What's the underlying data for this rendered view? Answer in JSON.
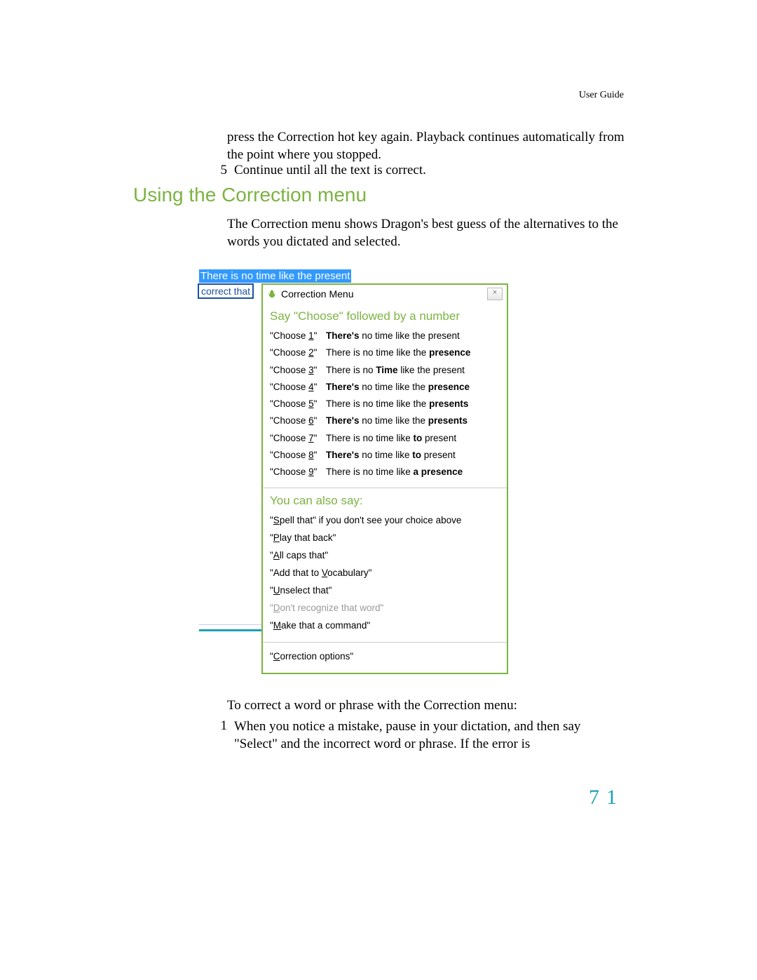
{
  "header": {
    "label": "User Guide"
  },
  "paragraphs": {
    "p1": "press the Correction hot key again. Playback continues automatically from the point where you stopped.",
    "step5_num": "5",
    "step5_text": "Continue until all the text is correct.",
    "p2": "The Correction menu shows Dragon's best guess of the alternatives to the words you dictated and selected.",
    "p3": "To correct a word or phrase with the Correction menu:",
    "step1_num": "1",
    "step1_text": "When you notice a mistake, pause in your dictation, and then say \"Select\" and the incorrect word or phrase. If the error is"
  },
  "section_heading": "Using the Correction menu",
  "annotation": {
    "label": "correct that"
  },
  "selected_text": "There is no time like the present",
  "menu": {
    "title": "Correction Menu",
    "close": "×",
    "choose_heading": "Say \"Choose\" followed by a number",
    "choices": [
      {
        "num": "1",
        "parts": [
          {
            "t": "There's",
            "b": true
          },
          {
            "t": " no time like the present",
            "b": false
          }
        ]
      },
      {
        "num": "2",
        "parts": [
          {
            "t": "There is no time like the ",
            "b": false
          },
          {
            "t": "presence",
            "b": true
          }
        ]
      },
      {
        "num": "3",
        "parts": [
          {
            "t": "There is no ",
            "b": false
          },
          {
            "t": "Time",
            "b": true
          },
          {
            "t": " like the present",
            "b": false
          }
        ]
      },
      {
        "num": "4",
        "parts": [
          {
            "t": "There's",
            "b": true
          },
          {
            "t": " no time like the ",
            "b": false
          },
          {
            "t": "presence",
            "b": true
          }
        ]
      },
      {
        "num": "5",
        "parts": [
          {
            "t": "There is no time like the ",
            "b": false
          },
          {
            "t": "presents",
            "b": true
          }
        ]
      },
      {
        "num": "6",
        "parts": [
          {
            "t": "There's",
            "b": true
          },
          {
            "t": " no time like the ",
            "b": false
          },
          {
            "t": "presents",
            "b": true
          }
        ]
      },
      {
        "num": "7",
        "parts": [
          {
            "t": "There is no time like ",
            "b": false
          },
          {
            "t": "to",
            "b": true
          },
          {
            "t": " present",
            "b": false
          }
        ]
      },
      {
        "num": "8",
        "parts": [
          {
            "t": "There's",
            "b": true
          },
          {
            "t": " no time like ",
            "b": false
          },
          {
            "t": "to",
            "b": true
          },
          {
            "t": " present",
            "b": false
          }
        ]
      },
      {
        "num": "9",
        "parts": [
          {
            "t": "There is no time like ",
            "b": false
          },
          {
            "t": "a presence",
            "b": true
          }
        ]
      }
    ],
    "also_heading": "You can also say:",
    "also": [
      {
        "pre": "\"",
        "u": "S",
        "post": "pell that\"  if you don't see your choice above",
        "disabled": false
      },
      {
        "pre": "\"",
        "u": "P",
        "post": "lay that back\"",
        "disabled": false
      },
      {
        "pre": "\"",
        "u": "A",
        "post": "ll caps that\"",
        "disabled": false
      },
      {
        "pre": "\"Add that to ",
        "u": "V",
        "post": "ocabulary\"",
        "disabled": false
      },
      {
        "pre": "\"",
        "u": "U",
        "post": "nselect that\"",
        "disabled": false
      },
      {
        "pre": "\"",
        "u": "D",
        "post": "on't recognize that word\"",
        "disabled": true
      },
      {
        "pre": "\"",
        "u": "M",
        "post": "ake that a command\"",
        "disabled": false
      }
    ],
    "options": {
      "pre": "\"",
      "u": "C",
      "post": "orrection options\""
    }
  },
  "page_number": "71"
}
